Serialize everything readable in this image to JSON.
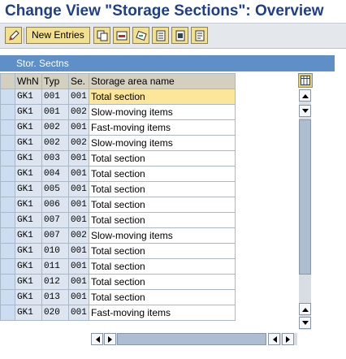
{
  "header": {
    "title": "Change View \"Storage Sections\": Overview"
  },
  "toolbar": {
    "new_entries_label": "New Entries",
    "icons": [
      "edit-icon",
      "copy-icon",
      "delete-icon",
      "undo-icon",
      "select-all-icon",
      "select-block-icon",
      "deselect-all-icon"
    ]
  },
  "table": {
    "title": "Stor. Sectns",
    "columns": [
      "WhN",
      "Typ",
      "Se.",
      "Storage area name"
    ],
    "rows": [
      {
        "whn": "GK1",
        "typ": "001",
        "se": "001",
        "name": "Total section"
      },
      {
        "whn": "GK1",
        "typ": "001",
        "se": "002",
        "name": "Slow-moving items"
      },
      {
        "whn": "GK1",
        "typ": "002",
        "se": "001",
        "name": "Fast-moving items"
      },
      {
        "whn": "GK1",
        "typ": "002",
        "se": "002",
        "name": "Slow-moving items"
      },
      {
        "whn": "GK1",
        "typ": "003",
        "se": "001",
        "name": "Total section"
      },
      {
        "whn": "GK1",
        "typ": "004",
        "se": "001",
        "name": "Total section"
      },
      {
        "whn": "GK1",
        "typ": "005",
        "se": "001",
        "name": "Total section"
      },
      {
        "whn": "GK1",
        "typ": "006",
        "se": "001",
        "name": "Total section"
      },
      {
        "whn": "GK1",
        "typ": "007",
        "se": "001",
        "name": "Total section"
      },
      {
        "whn": "GK1",
        "typ": "007",
        "se": "002",
        "name": "Slow-moving items"
      },
      {
        "whn": "GK1",
        "typ": "010",
        "se": "001",
        "name": "Total section"
      },
      {
        "whn": "GK1",
        "typ": "011",
        "se": "001",
        "name": "Total section"
      },
      {
        "whn": "GK1",
        "typ": "012",
        "se": "001",
        "name": "Total section"
      },
      {
        "whn": "GK1",
        "typ": "013",
        "se": "001",
        "name": "Total section"
      },
      {
        "whn": "GK1",
        "typ": "020",
        "se": "001",
        "name": "Fast-moving items"
      }
    ]
  },
  "colors": {
    "title": "#1d3f8c",
    "panel_header": "#5e8fc7",
    "highlight": "#fce69a",
    "button": "#f2e08e"
  }
}
